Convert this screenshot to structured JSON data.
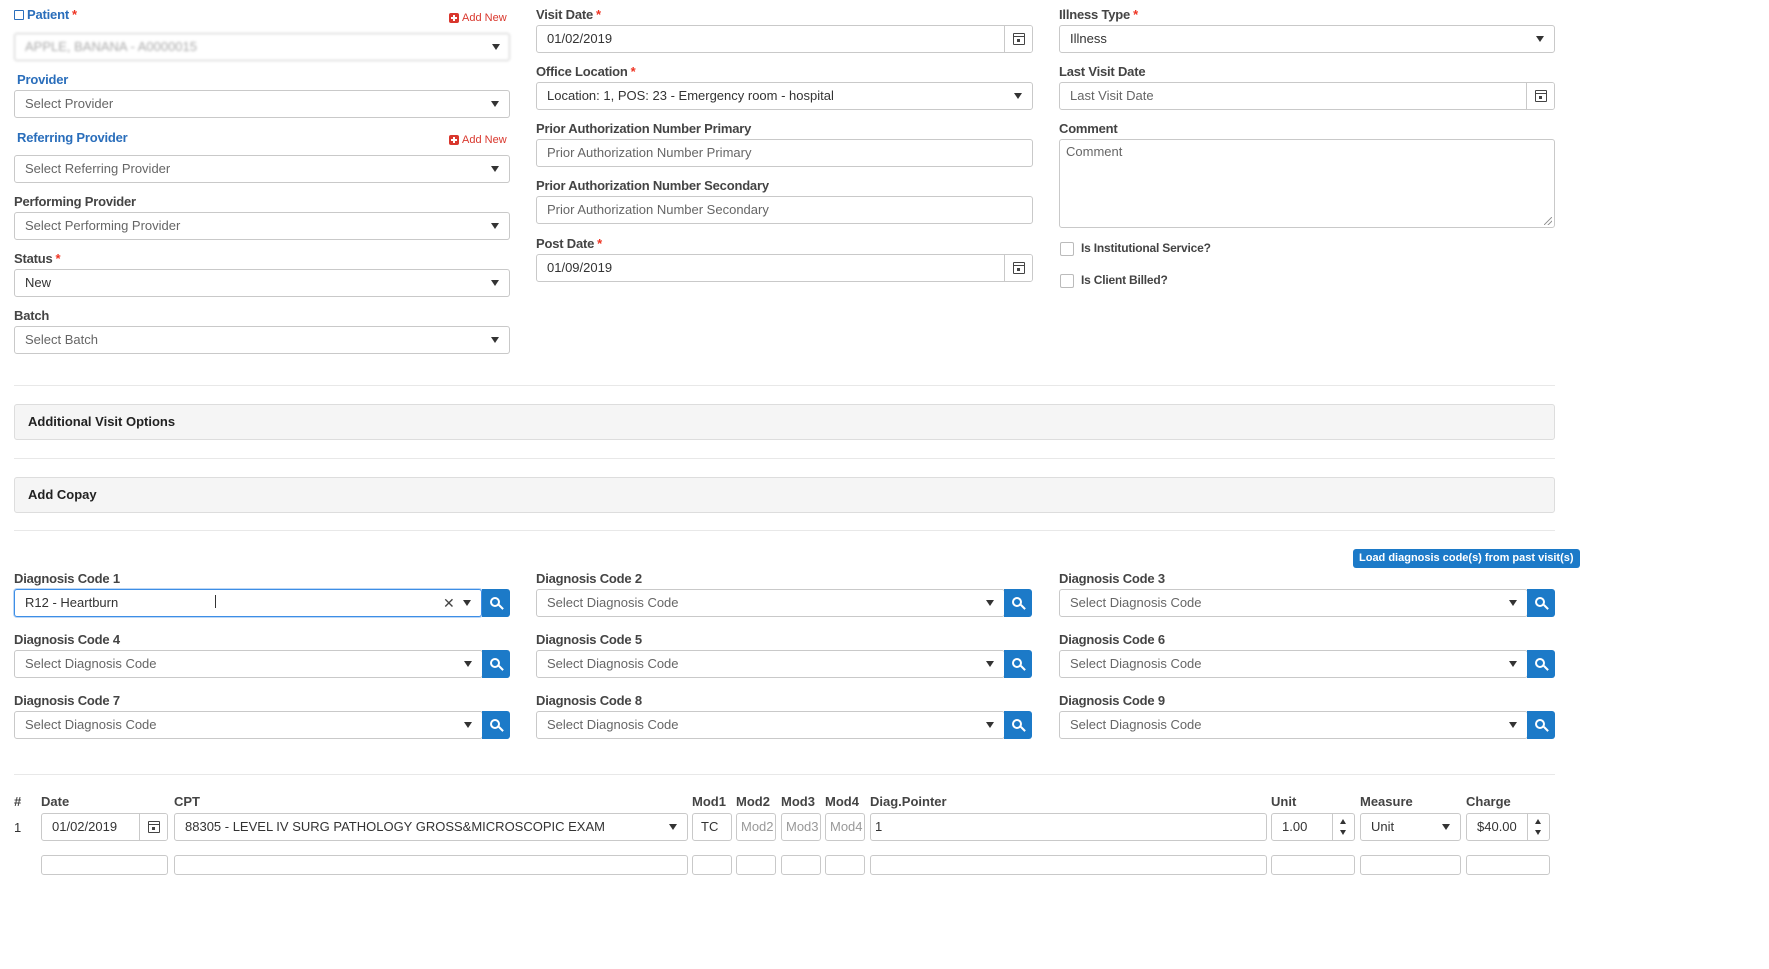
{
  "patient": {
    "label": "Patient",
    "value": "APPLE, BANANA - A0000015",
    "add_new": "Add New"
  },
  "provider": {
    "label": "Provider",
    "placeholder": "Select Provider"
  },
  "referring_provider": {
    "label": "Referring Provider",
    "placeholder": "Select Referring Provider",
    "add_new": "Add New"
  },
  "performing_provider": {
    "label": "Performing Provider",
    "placeholder": "Select Performing Provider"
  },
  "status": {
    "label": "Status",
    "value": "New"
  },
  "batch": {
    "label": "Batch",
    "placeholder": "Select Batch"
  },
  "visit_date": {
    "label": "Visit Date",
    "value": "01/02/2019"
  },
  "office_location": {
    "label": "Office Location",
    "value": "Location: 1, POS: 23 - Emergency room - hospital"
  },
  "prior_auth_primary": {
    "label": "Prior Authorization Number Primary",
    "placeholder": "Prior Authorization Number Primary"
  },
  "prior_auth_secondary": {
    "label": "Prior Authorization Number Secondary",
    "placeholder": "Prior Authorization Number Secondary"
  },
  "post_date": {
    "label": "Post Date",
    "value": "01/09/2019"
  },
  "illness_type": {
    "label": "Illness Type",
    "value": "Illness"
  },
  "last_visit_date": {
    "label": "Last Visit Date",
    "placeholder": "Last Visit Date"
  },
  "comment": {
    "label": "Comment",
    "placeholder": "Comment"
  },
  "institutional_service": {
    "label": "Is Institutional Service?",
    "checked": false
  },
  "client_billed": {
    "label": "Is Client Billed?",
    "checked": false
  },
  "panels": {
    "additional_visit_options": "Additional Visit Options",
    "add_copay": "Add Copay"
  },
  "load_diagnosis_button": "Load diagnosis code(s) from past visit(s)",
  "required_marker": "*",
  "diagnosis": [
    {
      "label": "Diagnosis Code 1",
      "value": "R12 - Heartburn"
    },
    {
      "label": "Diagnosis Code 2",
      "value": "Select Diagnosis Code"
    },
    {
      "label": "Diagnosis Code 3",
      "value": "Select Diagnosis Code"
    },
    {
      "label": "Diagnosis Code 4",
      "value": "Select Diagnosis Code"
    },
    {
      "label": "Diagnosis Code 5",
      "value": "Select Diagnosis Code"
    },
    {
      "label": "Diagnosis Code 6",
      "value": "Select Diagnosis Code"
    },
    {
      "label": "Diagnosis Code 7",
      "value": "Select Diagnosis Code"
    },
    {
      "label": "Diagnosis Code 8",
      "value": "Select Diagnosis Code"
    },
    {
      "label": "Diagnosis Code 9",
      "value": "Select Diagnosis Code"
    }
  ],
  "procedures": {
    "columns": {
      "num": "#",
      "date": "Date",
      "cpt": "CPT",
      "mod1": "Mod1",
      "mod2": "Mod2",
      "mod3": "Mod3",
      "mod4": "Mod4",
      "diag_pointer": "Diag.Pointer",
      "unit": "Unit",
      "measure": "Measure",
      "charge": "Charge"
    },
    "rows": [
      {
        "num": "1",
        "date": "01/02/2019",
        "cpt": "88305 - LEVEL IV SURG PATHOLOGY GROSS&MICROSCOPIC EXAM",
        "mod1": "TC",
        "mod2": "Mod2",
        "mod3": "Mod3",
        "mod4": "Mod4",
        "diag_pointer": "1",
        "unit": "1.00",
        "measure": "Unit",
        "charge": "$40.00"
      }
    ]
  },
  "icons": {
    "external": "external-link-icon",
    "calendar": "calendar-icon",
    "search": "search-icon",
    "plus": "plus-square-icon",
    "caret": "caret-down-icon",
    "clear": "clear-icon"
  },
  "colors": {
    "accent": "#1c7ac8",
    "link": "#2a6ebb",
    "required": "#e32222",
    "add_new": "#d9372d"
  }
}
